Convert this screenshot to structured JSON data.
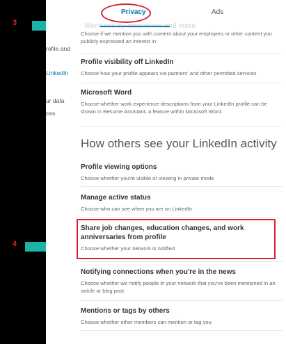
{
  "tabs": {
    "privacy": "Privacy",
    "ads": "Ads"
  },
  "annotations": {
    "step3": "3",
    "step4": "4"
  },
  "sidebar": {
    "items": [
      {
        "label": "rofile and"
      },
      {
        "label": "LinkedIn"
      },
      {
        "label": "ur data"
      },
      {
        "label": "ces"
      }
    ]
  },
  "partial_title": "Mentions by employers and more",
  "settings_top": [
    {
      "title": "",
      "desc": "Choose if we mention you with content about your employers or other content you publicly expressed an interest in"
    },
    {
      "title": "Profile visibility off LinkedIn",
      "desc": "Choose how your profile appears via partners' and other permitted services"
    },
    {
      "title": "Microsoft Word",
      "desc": "Choose whether work experience descriptions from your LinkedIn profile can be shown in Resume Assistant, a feature within Microsoft Word."
    }
  ],
  "section_heading": "How others see your LinkedIn activity",
  "settings_activity": [
    {
      "title": "Profile viewing options",
      "desc": "Choose whether you're visible or viewing in private mode"
    },
    {
      "title": "Manage active status",
      "desc": "Choose who can see when you are on LinkedIn"
    },
    {
      "title": "Share job changes, education changes, and work anniversaries from profile",
      "desc": "Choose whether your network is notified"
    },
    {
      "title": "Notifying connections when you're in the news",
      "desc": "Choose whether we notify people in your network that you've been mentioned in an article or blog post"
    },
    {
      "title": "Mentions or tags by others",
      "desc": "Choose whether other members can mention or tag you"
    }
  ],
  "colors": {
    "accent": "#0073b1",
    "annotation_red": "#d9232d",
    "arrow_teal": "#1bb3a8"
  }
}
